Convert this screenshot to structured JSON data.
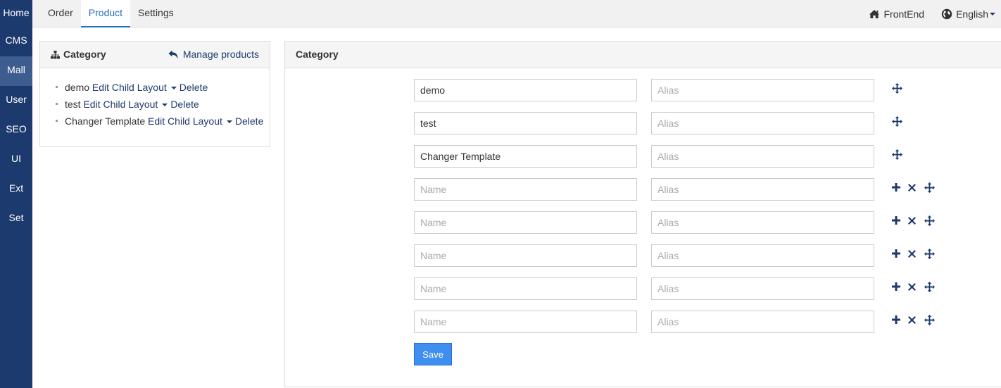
{
  "sidebar": {
    "items": [
      {
        "label": "Home"
      },
      {
        "label": "CMS"
      },
      {
        "label": "Mall"
      },
      {
        "label": "User"
      },
      {
        "label": "SEO"
      },
      {
        "label": "UI"
      },
      {
        "label": "Ext"
      },
      {
        "label": "Set"
      }
    ],
    "active": "Mall"
  },
  "topbar": {
    "tabs": [
      {
        "label": "Order"
      },
      {
        "label": "Product"
      },
      {
        "label": "Settings"
      }
    ],
    "active_tab": "Product",
    "frontend_label": "FrontEnd",
    "language_label": "English"
  },
  "left_panel": {
    "title": "Category",
    "manage_link": "Manage products",
    "categories": [
      {
        "name": "demo",
        "edit_label": "Edit Child Layout",
        "delete_label": "Delete"
      },
      {
        "name": "test",
        "edit_label": "Edit Child Layout",
        "delete_label": "Delete"
      },
      {
        "name": "Changer Template",
        "edit_label": "Edit Child Layout",
        "delete_label": "Delete"
      }
    ]
  },
  "right_panel": {
    "title": "Category",
    "rows": [
      {
        "name_value": "demo",
        "name_placeholder": "Name",
        "alias_value": "",
        "alias_placeholder": "Alias"
      },
      {
        "name_value": "test",
        "name_placeholder": "Name",
        "alias_value": "",
        "alias_placeholder": "Alias"
      },
      {
        "name_value": "Changer Template",
        "name_placeholder": "Name",
        "alias_value": "",
        "alias_placeholder": "Alias"
      },
      {
        "name_value": "",
        "name_placeholder": "Name",
        "alias_value": "",
        "alias_placeholder": "Alias"
      },
      {
        "name_value": "",
        "name_placeholder": "Name",
        "alias_value": "",
        "alias_placeholder": "Alias"
      },
      {
        "name_value": "",
        "name_placeholder": "Name",
        "alias_value": "",
        "alias_placeholder": "Alias"
      },
      {
        "name_value": "",
        "name_placeholder": "Name",
        "alias_value": "",
        "alias_placeholder": "Alias"
      },
      {
        "name_value": "",
        "name_placeholder": "Name",
        "alias_value": "",
        "alias_placeholder": "Alias"
      }
    ],
    "save_label": "Save"
  },
  "colors": {
    "sidebar_bg": "#1d3a6e",
    "sidebar_active": "#3d5d8f",
    "link": "#1d3a6e",
    "tab_active": "#2a6ebb",
    "save_button": "#3f8ff0"
  },
  "icons": {
    "sitemap": "sitemap-icon",
    "reply": "reply-icon",
    "home": "home-icon",
    "globe": "globe-icon",
    "plus": "plus-icon",
    "remove": "remove-icon",
    "move": "move-icon"
  }
}
